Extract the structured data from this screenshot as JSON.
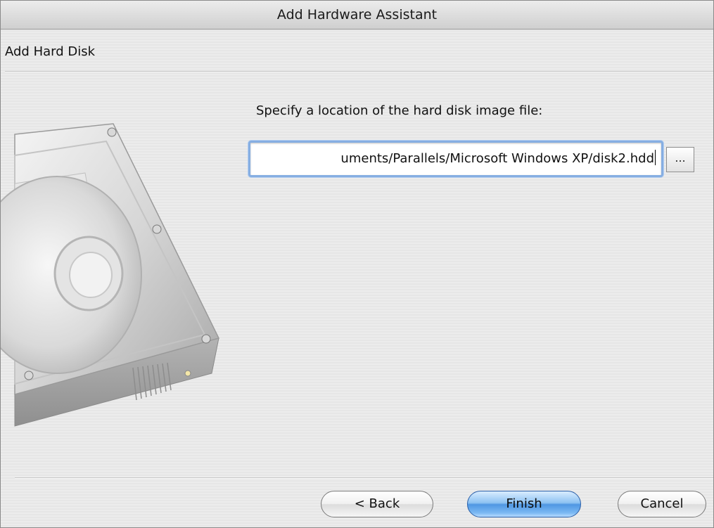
{
  "window": {
    "title": "Add Hardware Assistant"
  },
  "section": {
    "title": "Add Hard Disk"
  },
  "form": {
    "prompt": "Specify a location of the hard disk image file:",
    "path_value": "uments/Parallels/Microsoft Windows XP/disk2.hdd",
    "browse_label": "..."
  },
  "buttons": {
    "back_label": "< Back",
    "finish_label": "Finish",
    "cancel_label": "Cancel"
  },
  "illustration": {
    "icon": "hard-disk-icon"
  },
  "colors": {
    "default_button": "#5aa0e8",
    "focus_ring": "#86aee2"
  }
}
